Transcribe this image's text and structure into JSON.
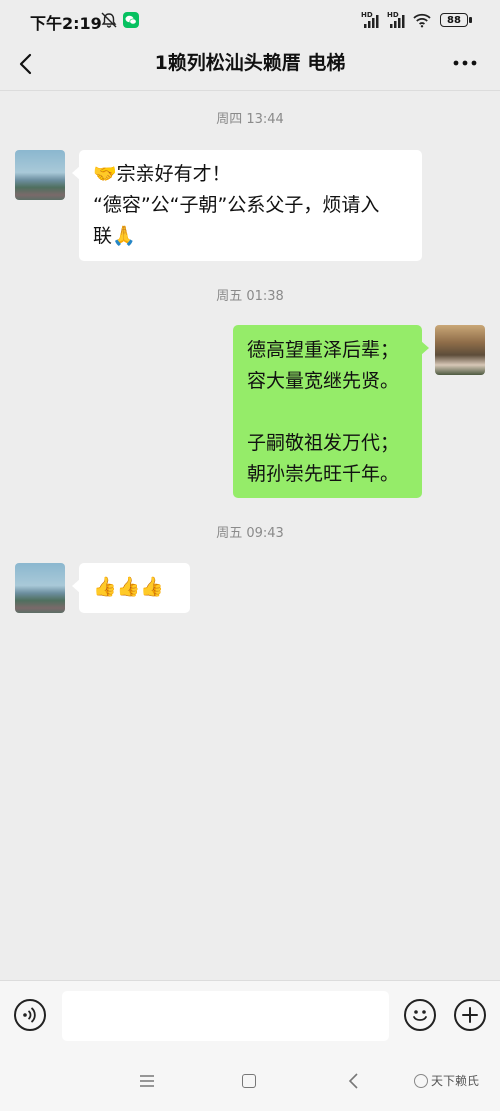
{
  "status_bar": {
    "time": "下午2:19",
    "signal_label_1": "HD",
    "signal_label_2": "HD",
    "battery": "88"
  },
  "header": {
    "title": "1赖列松汕头赖厝 电梯"
  },
  "messages": [
    {
      "timestamp": "周四 13:44",
      "lines": [
        "🤝宗亲好有才！",
        "“德容”公“子朝”公系父子，烦请入",
        "联🙏"
      ]
    },
    {
      "timestamp": "周五 01:38",
      "lines": [
        "德高望重泽后辈；",
        "容大量宽继先贤。",
        "",
        "子嗣敬祖发万代；",
        "朝孙崇先旺千年。"
      ]
    },
    {
      "timestamp": "周五 09:43",
      "lines": [
        "👍👍👍"
      ]
    }
  ],
  "input": {
    "value": "",
    "placeholder": ""
  },
  "watermark": "天下赖氏",
  "colors": {
    "background": "#ededed",
    "outgoing_bubble": "#95ec69",
    "incoming_bubble": "#ffffff",
    "wechat_green": "#07c160"
  }
}
